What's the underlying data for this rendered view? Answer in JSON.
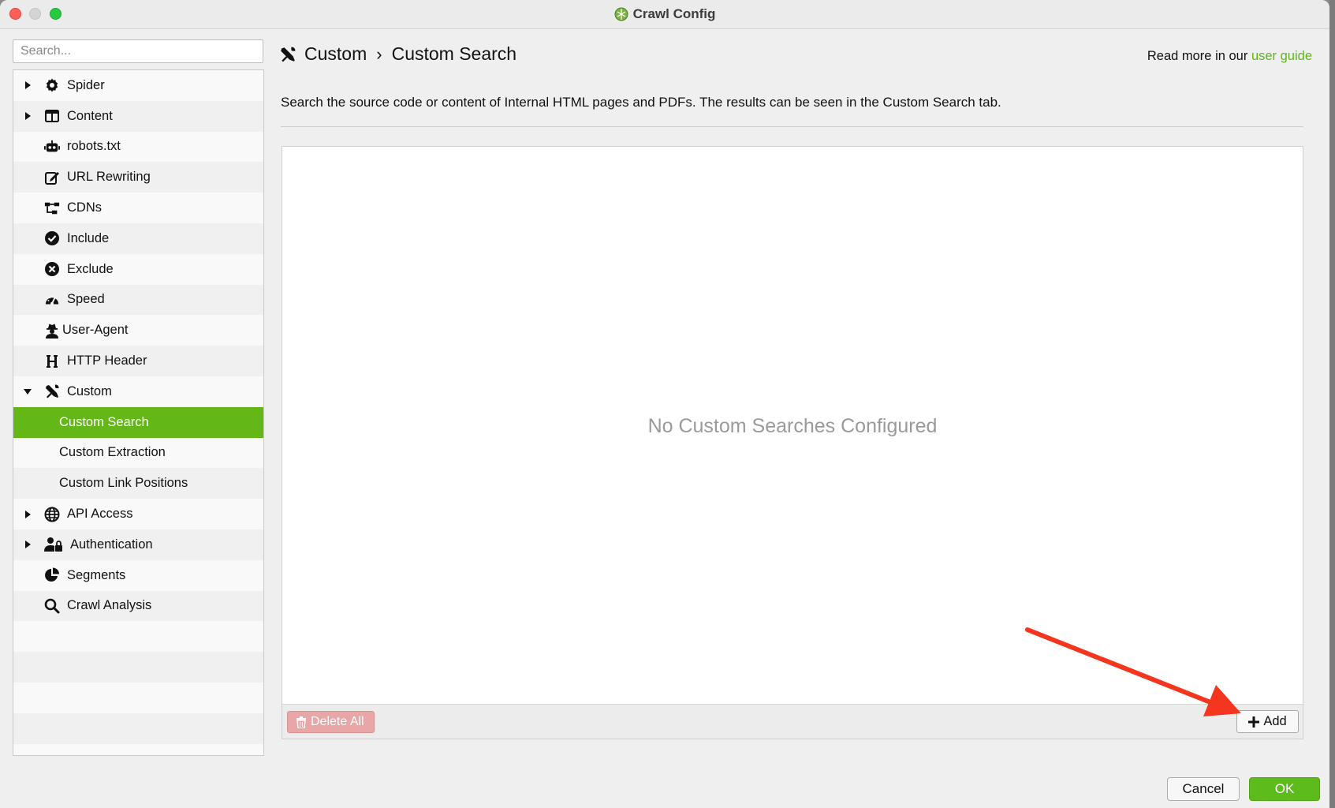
{
  "window": {
    "title": "Crawl Config"
  },
  "search": {
    "placeholder": "Search..."
  },
  "sidebar": {
    "items": [
      {
        "label": "Spider",
        "icon": "gear-icon",
        "expander": "collapsed"
      },
      {
        "label": "Content",
        "icon": "columns-icon",
        "expander": "collapsed"
      },
      {
        "label": "robots.txt",
        "icon": "robot-icon",
        "expander": "none"
      },
      {
        "label": "URL Rewriting",
        "icon": "edit-icon",
        "expander": "none"
      },
      {
        "label": "CDNs",
        "icon": "network-icon",
        "expander": "none"
      },
      {
        "label": "Include",
        "icon": "check-circle-icon",
        "expander": "none"
      },
      {
        "label": "Exclude",
        "icon": "x-circle-icon",
        "expander": "none"
      },
      {
        "label": "Speed",
        "icon": "gauge-icon",
        "expander": "none"
      },
      {
        "label": "User-Agent",
        "icon": "user-secret-icon",
        "expander": "none"
      },
      {
        "label": "HTTP Header",
        "icon": "h-icon",
        "expander": "none"
      },
      {
        "label": "Custom",
        "icon": "tools-icon",
        "expander": "expanded"
      },
      {
        "label": "Custom Search",
        "child": true,
        "selected": true
      },
      {
        "label": "Custom Extraction",
        "child": true
      },
      {
        "label": "Custom Link Positions",
        "child": true
      },
      {
        "label": "API Access",
        "icon": "globe-icon",
        "expander": "collapsed"
      },
      {
        "label": "Authentication",
        "icon": "user-lock-icon",
        "expander": "collapsed"
      },
      {
        "label": "Segments",
        "icon": "pie-chart-icon",
        "expander": "none"
      },
      {
        "label": "Crawl Analysis",
        "icon": "search-icon",
        "expander": "none"
      }
    ]
  },
  "header": {
    "section": "Custom",
    "separator": "›",
    "page": "Custom Search",
    "guide_prefix": "Read more in our",
    "guide_link": "user guide"
  },
  "main": {
    "description": "Search the source code or content of Internal HTML pages and PDFs. The results can be seen in the Custom Search tab.",
    "empty_message": "No Custom Searches Configured",
    "delete_all_label": "Delete All",
    "add_label": "Add"
  },
  "footer": {
    "cancel_label": "Cancel",
    "ok_label": "OK"
  },
  "colors": {
    "accent": "#63b716",
    "annotation_arrow": "#f3361d",
    "delete_disabled": "#e9a6a6"
  }
}
